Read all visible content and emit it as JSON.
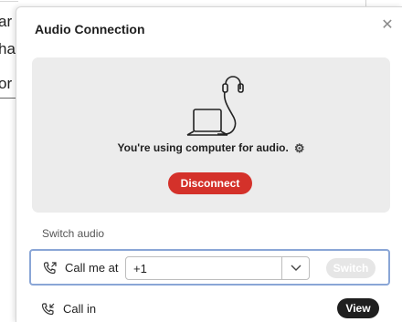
{
  "background": {
    "fragments": [
      "ar",
      "ha",
      "or"
    ]
  },
  "dialog": {
    "title": "Audio Connection",
    "close_icon": "close-icon",
    "status_text": "You're using computer for audio.",
    "settings_icon": "gear-icon",
    "disconnect_label": "Disconnect",
    "switch_audio_label": "Switch audio",
    "call_me": {
      "label": "Call me at",
      "country_code": "+1",
      "switch_label": "Switch"
    },
    "call_in": {
      "label": "Call in",
      "view_label": "View"
    }
  },
  "colors": {
    "disconnect": "#d4312a",
    "focus_border": "#8aa6d6",
    "panel": "#ececec",
    "view_button": "#1f1f1f"
  }
}
